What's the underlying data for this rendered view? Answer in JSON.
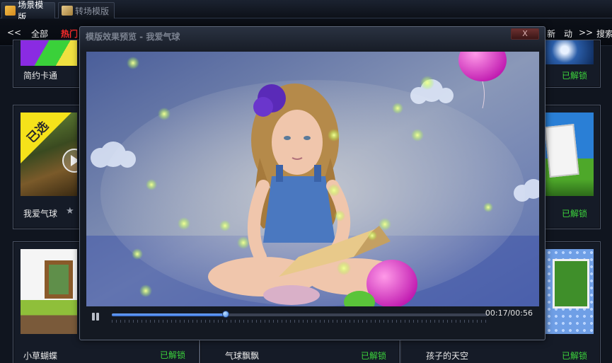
{
  "tabs": [
    {
      "label": "场景模版",
      "active": true,
      "icon": "scene-template-icon"
    },
    {
      "label": "转场模版",
      "active": false,
      "icon": "transition-template-icon"
    }
  ],
  "category_bar": {
    "prev": "<<",
    "all": "全部",
    "hot": "热门",
    "right_items": [
      "新",
      "动"
    ],
    "next": ">>",
    "search": "搜索"
  },
  "cards": [
    {
      "label": "简约卡通",
      "status": "已解锁"
    },
    {
      "label": "我爱气球",
      "badge": "已选",
      "status": "已解锁"
    },
    {
      "label": "小草蝴蝶",
      "status": "已解锁"
    },
    {
      "label": "气球飘飘",
      "status": "已解锁"
    },
    {
      "label": "孩子的天空",
      "status": "已解锁"
    }
  ],
  "preview": {
    "title": "模版效果预览 - 我爱气球",
    "close": "X",
    "progress": 0.303,
    "time": "00:17/00:56"
  },
  "colors": {
    "accent": "#3a6fd1",
    "hot": "#ff2b2b",
    "unlocked": "#3cd43c",
    "badge": "#f5e21a"
  }
}
